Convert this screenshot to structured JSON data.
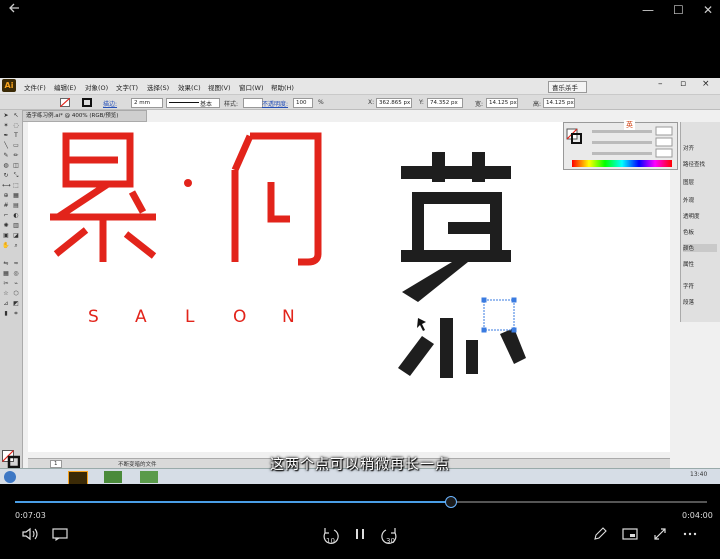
{
  "player": {
    "back_icon": "arrow-left-icon",
    "minimize": "—",
    "maximize": "☐",
    "close": "✕",
    "subtitle": "这两个点可以稍微再长一点",
    "time_current": "0:07:03",
    "time_remaining": "0:04:00",
    "progress": 0.63,
    "skip_back": "10",
    "skip_forward": "30",
    "accent": "#4a9ee6"
  },
  "illustrator": {
    "logo": "Ai",
    "menus": [
      "文件(F)",
      "编辑(E)",
      "对象(O)",
      "文字(T)",
      "选择(S)",
      "效果(C)",
      "视图(V)",
      "窗口(W)",
      "帮助(H)"
    ],
    "workspace": "喜乐杀手",
    "control": {
      "stroke_label": "描边:",
      "stroke_weight": "2 mm",
      "basic": "基本",
      "style_label": "样式:",
      "opacity_label": "不透明度:",
      "opacity": "100",
      "opacity_unit": "%",
      "x_label": "X:",
      "x": "362.865 px",
      "y_label": "Y:",
      "y": "74.352 px",
      "w_label": "宽:",
      "w": "14.125 px",
      "h_label": "高:",
      "h": "14.125 px"
    },
    "doc_tab": "造字练习例.ai* @ 400% (RGB/预览)",
    "zoom_status": "1",
    "status_text": "不断变暗的文件",
    "panels": [
      "颜色",
      "外观",
      "透明度",
      "色板",
      "属性",
      "字符",
      "段落",
      "路径查找",
      "图层",
      "对齐"
    ],
    "ime": "英",
    "artwork": {
      "red_color": "#e2241b",
      "black_color": "#1e1e1e",
      "salon_letters": [
        "S",
        "A",
        "L",
        "O",
        "N"
      ]
    },
    "clock": "13:40"
  }
}
